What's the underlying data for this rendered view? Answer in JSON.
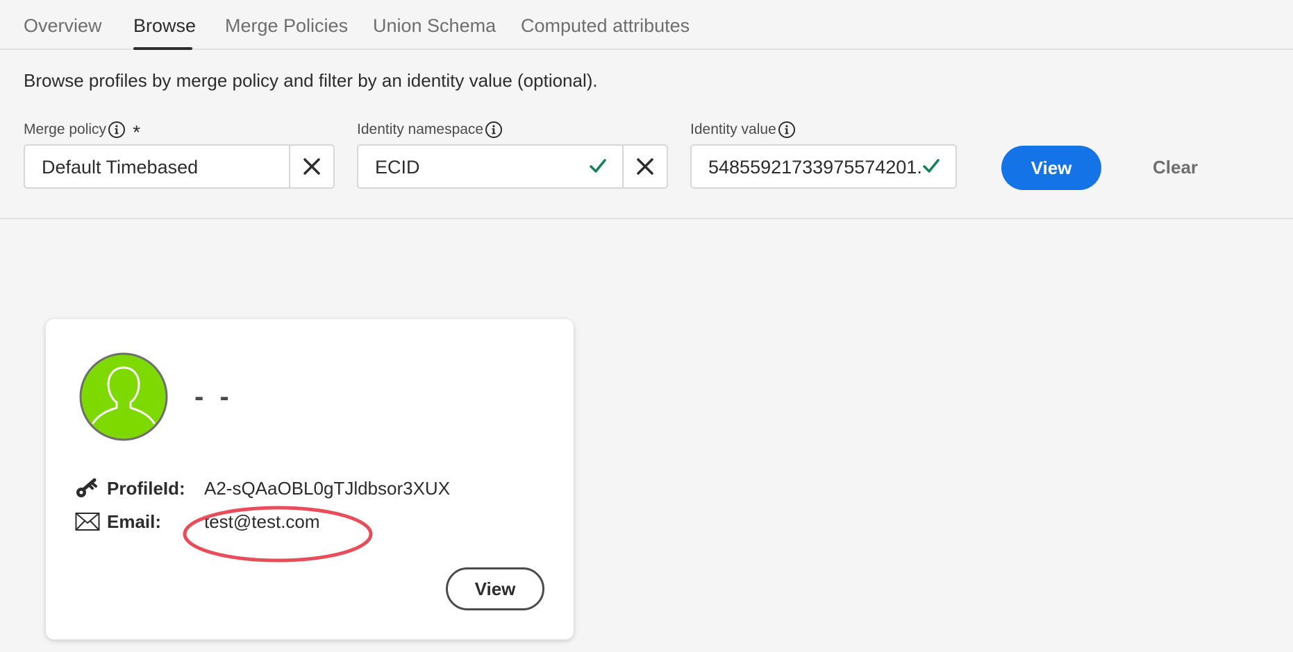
{
  "tabs": [
    {
      "label": "Overview",
      "selected": false
    },
    {
      "label": "Browse",
      "selected": true
    },
    {
      "label": "Merge Policies",
      "selected": false
    },
    {
      "label": "Union Schema",
      "selected": false
    },
    {
      "label": "Computed attributes",
      "selected": false
    }
  ],
  "description": "Browse profiles by merge policy and filter by an identity value (optional).",
  "filters": {
    "merge_policy": {
      "label": "Merge policy",
      "value": "Default Timebased",
      "required": true
    },
    "identity_namespace": {
      "label": "Identity namespace",
      "value": "ECID"
    },
    "identity_value": {
      "label": "Identity value",
      "value": "54855921733975574201..."
    }
  },
  "actions": {
    "view_label": "View",
    "clear_label": "Clear"
  },
  "profile_card": {
    "display_name": "- -",
    "avatar_color": "#7ed900",
    "attributes": [
      {
        "label": "ProfileId:",
        "value": "A2-sQAaOBL0gTJldbsor3XUX",
        "icon": "key-icon"
      },
      {
        "label": "Email:",
        "value": "test@test.com",
        "icon": "envelope-icon"
      }
    ],
    "view_label": "View"
  },
  "colors": {
    "accent": "#1473e6",
    "check": "#12805c",
    "annotation": "#e94d5a"
  }
}
